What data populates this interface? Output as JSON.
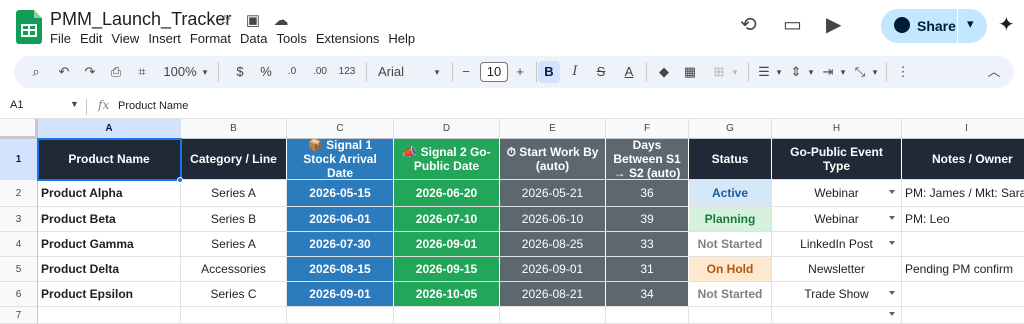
{
  "app": {
    "doc_title": "PMM_Launch_Tracker",
    "menu": [
      "File",
      "Edit",
      "View",
      "Insert",
      "Format",
      "Data",
      "Tools",
      "Extensions",
      "Help"
    ],
    "share_label": "Share",
    "brand_color": "#0f9d58"
  },
  "toolbar": {
    "zoom": "100%",
    "currency": "$",
    "percent": "%",
    "dec_decrease": ".0",
    "dec_increase": ".00",
    "format_123": "123",
    "font": "Arial",
    "font_size": "10",
    "minus": "−",
    "plus": "+",
    "bold": "B"
  },
  "formula_bar": {
    "cell_ref": "A1",
    "fx": "fx",
    "value": "Product Name"
  },
  "columns": [
    "A",
    "B",
    "C",
    "D",
    "E",
    "F",
    "G",
    "H",
    "I"
  ],
  "selected_column": "A",
  "row_numbers": [
    "1",
    "2",
    "3",
    "4",
    "5",
    "6",
    "7"
  ],
  "headers": {
    "a": "Product Name",
    "b": "Category / Line",
    "c": "📦 Signal 1 Stock Arrival Date",
    "d": "📣 Signal 2 Go-Public Date",
    "e": "⏱ Start Work By (auto)",
    "f": "Days Between S1 → S2 (auto)",
    "g": "Status",
    "h": "Go-Public Event Type",
    "i": "Notes / Owner"
  },
  "rows": [
    {
      "a": "Product Alpha",
      "b": "Series A",
      "c": "2026-05-15",
      "d": "2026-06-20",
      "e": "2026-05-21",
      "f": "36",
      "g": "Active",
      "g_style": "active",
      "h": "Webinar",
      "i": "PM: James / Mkt: Sara"
    },
    {
      "a": "Product Beta",
      "b": "Series B",
      "c": "2026-06-01",
      "d": "2026-07-10",
      "e": "2026-06-10",
      "f": "39",
      "g": "Planning",
      "g_style": "planning",
      "h": "Webinar",
      "i": "PM: Leo"
    },
    {
      "a": "Product Gamma",
      "b": "Series A",
      "c": "2026-07-30",
      "d": "2026-09-01",
      "e": "2026-08-25",
      "f": "33",
      "g": "Not Started",
      "g_style": "notstarted",
      "h": "LinkedIn Post",
      "i": ""
    },
    {
      "a": "Product Delta",
      "b": "Accessories",
      "c": "2026-08-15",
      "d": "2026-09-15",
      "e": "2026-09-01",
      "f": "31",
      "g": "On Hold",
      "g_style": "onhold",
      "h": "Newsletter",
      "i": "Pending PM confirm"
    },
    {
      "a": "Product Epsilon",
      "b": "Series C",
      "c": "2026-09-01",
      "d": "2026-10-05",
      "e": "2026-08-21",
      "f": "34",
      "g": "Not Started",
      "g_style": "notstarted",
      "h": "Trade Show",
      "i": ""
    }
  ],
  "colors": {
    "header_dark": "#1f2a36",
    "signal1_blue": "#2b7bbd",
    "signal2_green": "#23a55a",
    "auto_gray": "#5c6770",
    "selection_blue": "#1a73e8"
  }
}
